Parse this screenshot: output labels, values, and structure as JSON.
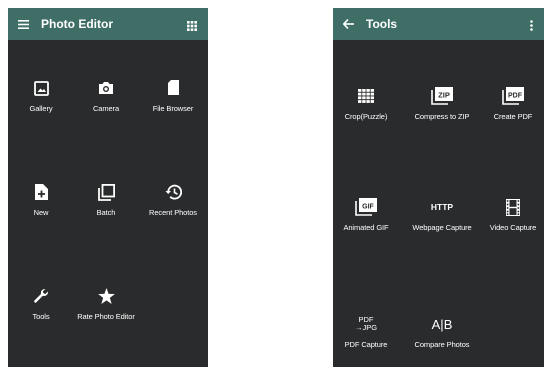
{
  "left_screen": {
    "title": "Photo Editor",
    "menu_icon": "hamburger-menu-icon",
    "grid_icon": "grid-view-icon",
    "items": [
      {
        "label": "Gallery",
        "icon": "gallery-image-icon"
      },
      {
        "label": "Camera",
        "icon": "camera-icon"
      },
      {
        "label": "File Browser",
        "icon": "file-icon"
      },
      {
        "label": "New",
        "icon": "new-file-icon"
      },
      {
        "label": "Batch",
        "icon": "batch-icon"
      },
      {
        "label": "Recent Photos",
        "icon": "history-icon"
      },
      {
        "label": "Tools",
        "icon": "wrench-icon"
      },
      {
        "label": "Rate Photo Editor",
        "icon": "star-icon"
      }
    ]
  },
  "right_screen": {
    "title": "Tools",
    "back_icon": "back-arrow-icon",
    "overflow_icon": "overflow-menu-icon",
    "items": [
      {
        "label": "Crop(Puzzle)",
        "icon": "puzzle-grid-icon"
      },
      {
        "label": "Compress to ZIP",
        "icon": "zip-icon",
        "icon_text": "ZIP"
      },
      {
        "label": "Create PDF",
        "icon": "pdf-icon",
        "icon_text": "PDF"
      },
      {
        "label": "Animated GIF",
        "icon": "gif-icon",
        "icon_text": "GIF"
      },
      {
        "label": "Webpage Capture",
        "icon": "http-icon",
        "icon_text": "HTTP"
      },
      {
        "label": "Video Capture",
        "icon": "film-icon"
      },
      {
        "label": "PDF Capture",
        "icon": "pdf-to-jpg-icon",
        "icon_text_top": "PDF",
        "icon_text_bottom": "→JPG"
      },
      {
        "label": "Compare Photos",
        "icon": "compare-icon",
        "icon_text": "A|B"
      }
    ]
  },
  "colors": {
    "appbar": "#3f6e67",
    "background": "#2a2b2c",
    "text": "#ffffff"
  }
}
